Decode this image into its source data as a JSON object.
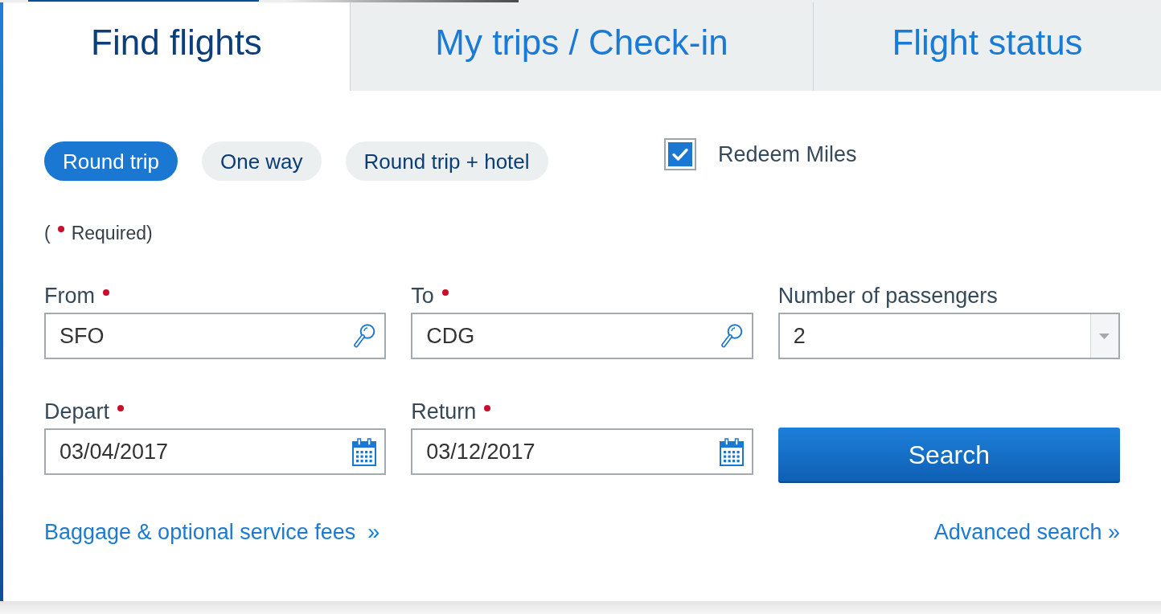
{
  "tabs": [
    {
      "label": "Find flights",
      "selected": true
    },
    {
      "label": "My trips / Check-in",
      "selected": false
    },
    {
      "label": "Flight status",
      "selected": false
    }
  ],
  "trip_types": [
    {
      "label": "Round trip",
      "selected": true
    },
    {
      "label": "One way",
      "selected": false
    },
    {
      "label": "Round trip + hotel",
      "selected": false
    }
  ],
  "redeem_miles": {
    "label": "Redeem Miles",
    "checked": true
  },
  "required_note": {
    "open": "(",
    "text": "Required)"
  },
  "fields": [
    {
      "kind": "search",
      "label": "From",
      "required": true,
      "value": "SFO"
    },
    {
      "kind": "search",
      "label": "To",
      "required": true,
      "value": "CDG"
    },
    {
      "kind": "select",
      "label": "Number of passengers",
      "required": false,
      "value": "2"
    },
    {
      "kind": "date",
      "label": "Depart",
      "required": true,
      "value": "03/04/2017"
    },
    {
      "kind": "date",
      "label": "Return",
      "required": true,
      "value": "03/12/2017"
    }
  ],
  "search_button": {
    "label": "Search"
  },
  "links": [
    {
      "label": "Baggage & optional service fees  »"
    },
    {
      "label": "Advanced search »"
    }
  ]
}
